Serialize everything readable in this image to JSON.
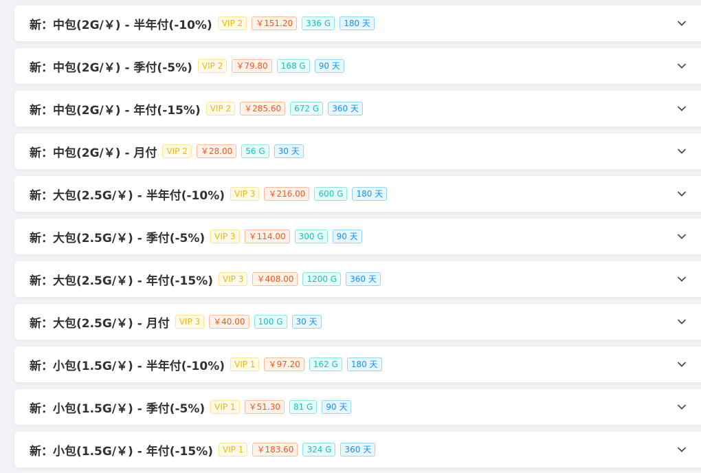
{
  "plans": [
    {
      "title": "新：中包(2G/￥) - 半年付(-10%)",
      "vip": "VIP 2",
      "price": "￥151.20",
      "data": "336 G",
      "days": "180 天"
    },
    {
      "title": "新：中包(2G/￥) - 季付(-5%)",
      "vip": "VIP 2",
      "price": "￥79.80",
      "data": "168 G",
      "days": "90 天"
    },
    {
      "title": "新：中包(2G/￥) - 年付(-15%)",
      "vip": "VIP 2",
      "price": "￥285.60",
      "data": "672 G",
      "days": "360 天"
    },
    {
      "title": "新：中包(2G/￥) - 月付",
      "vip": "VIP 2",
      "price": "￥28.00",
      "data": "56 G",
      "days": "30 天"
    },
    {
      "title": "新：大包(2.5G/￥) - 半年付(-10%)",
      "vip": "VIP 3",
      "price": "￥216.00",
      "data": "600 G",
      "days": "180 天"
    },
    {
      "title": "新：大包(2.5G/￥) - 季付(-5%)",
      "vip": "VIP 3",
      "price": "￥114.00",
      "data": "300 G",
      "days": "90 天"
    },
    {
      "title": "新：大包(2.5G/￥) - 年付(-15%)",
      "vip": "VIP 3",
      "price": "￥408.00",
      "data": "1200 G",
      "days": "360 天"
    },
    {
      "title": "新：大包(2.5G/￥) - 月付",
      "vip": "VIP 3",
      "price": "￥40.00",
      "data": "100 G",
      "days": "30 天"
    },
    {
      "title": "新：小包(1.5G/￥) - 半年付(-10%)",
      "vip": "VIP 1",
      "price": "￥97.20",
      "data": "162 G",
      "days": "180 天"
    },
    {
      "title": "新：小包(1.5G/￥) - 季付(-5%)",
      "vip": "VIP 1",
      "price": "￥51.30",
      "data": "81 G",
      "days": "90 天"
    },
    {
      "title": "新：小包(1.5G/￥) - 年付(-15%)",
      "vip": "VIP 1",
      "price": "￥183.60",
      "data": "324 G",
      "days": "360 天"
    }
  ],
  "icons": {
    "expand": "chevron-down-icon"
  },
  "colors": {
    "vip": "#f3b600",
    "price": "#fa541c",
    "data": "#13c2c2",
    "days": "#1890ff",
    "title": "#303133"
  }
}
